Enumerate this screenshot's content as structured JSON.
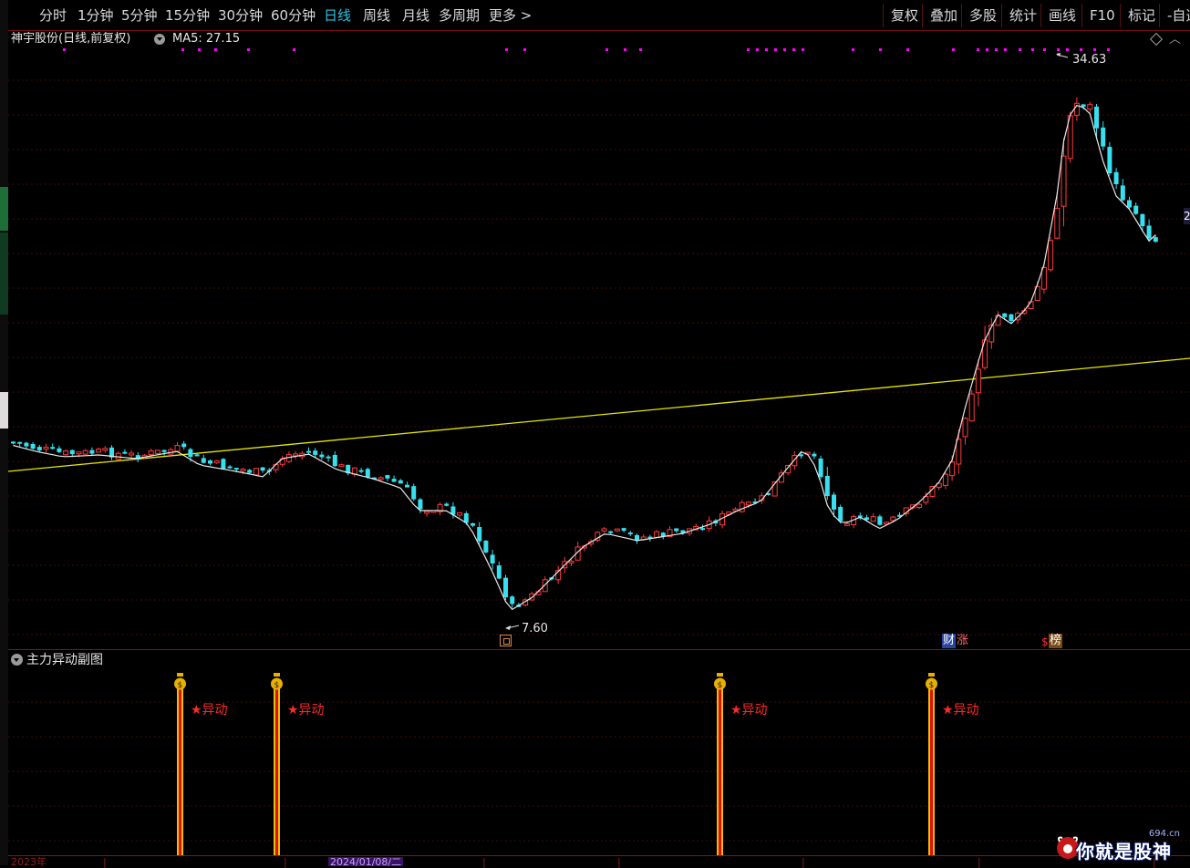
{
  "toolbar": {
    "periods": [
      {
        "label": "分时",
        "active": false
      },
      {
        "label": "1分钟",
        "active": false
      },
      {
        "label": "5分钟",
        "active": false
      },
      {
        "label": "15分钟",
        "active": false
      },
      {
        "label": "30分钟",
        "active": false
      },
      {
        "label": "60分钟",
        "active": false
      },
      {
        "label": "日线",
        "active": true
      },
      {
        "label": "周线",
        "active": false
      },
      {
        "label": "月线",
        "active": false
      },
      {
        "label": "多周期",
        "active": false
      }
    ],
    "more_label": "更多 >",
    "right_buttons": [
      "复权",
      "叠加",
      "多股",
      "统计",
      "画线",
      "F10",
      "标记",
      "-自选"
    ]
  },
  "chart": {
    "title": "神宇股份(日线,前复权)",
    "ma5_label": "MA5: 27.15",
    "high_label": "34.63",
    "low_label": "7.60",
    "badges": {
      "cai": "财",
      "zhang": "涨",
      "dollar": "$",
      "bang": "榜"
    },
    "colors": {
      "up": "#ff3a3a",
      "down": "#36e0f0",
      "ma5": "#e8e8e8",
      "trend": "#e6e600",
      "signal": "#ff00ff",
      "grid": "#5a0a0a"
    }
  },
  "sub_panel": {
    "title": "主力异动副图",
    "signal_label": "★异动",
    "signal_icon": "money-bag-icon",
    "signal_count": 4
  },
  "xaxis": {
    "left_label": "2023年",
    "highlight_label": "2024/01/08/二"
  },
  "right_tick": "2",
  "watermark": {
    "url": "694.cn",
    "text": "你就是股神"
  }
}
